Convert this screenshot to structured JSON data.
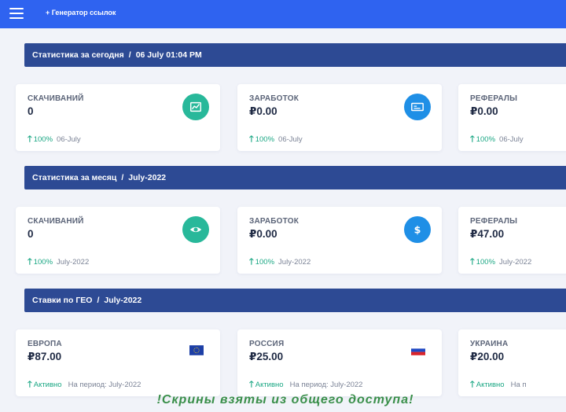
{
  "header": {
    "link_label": "+ Генератор ссылок"
  },
  "sections": {
    "today": {
      "label": "Статистика за сегодня",
      "period": "06 July 01:04 PM"
    },
    "month": {
      "label": "Статистика за месяц",
      "period": "July-2022"
    },
    "geo": {
      "label": "Ставки по ГЕО",
      "period": "July-2022"
    }
  },
  "today_cards": [
    {
      "label": "СКАЧИВАНИЙ",
      "value": "0",
      "pct": "100%",
      "date": "06-July",
      "icon": "chart-icon",
      "color": "#28b89a"
    },
    {
      "label": "ЗАРАБОТОК",
      "value": "₽0.00",
      "pct": "100%",
      "date": "06-July",
      "icon": "money-icon",
      "color": "#1f8fe6"
    },
    {
      "label": "РЕФЕРАЛЫ",
      "value": "₽0.00",
      "pct": "100%",
      "date": "06-July"
    }
  ],
  "month_cards": [
    {
      "label": "СКАЧИВАНИЙ",
      "value": "0",
      "pct": "100%",
      "date": "July-2022",
      "icon": "eye-icon",
      "color": "#28b89a"
    },
    {
      "label": "ЗАРАБОТОК",
      "value": "₽0.00",
      "pct": "100%",
      "date": "July-2022",
      "icon": "dollar-icon",
      "color": "#1f8fe6"
    },
    {
      "label": "РЕФЕРАЛЫ",
      "value": "₽47.00",
      "pct": "100%",
      "date": "July-2022"
    }
  ],
  "geo_cards": [
    {
      "label": "ЕВРОПА",
      "value": "₽87.00",
      "status": "Активно",
      "period": "На период: July-2022",
      "icon": "eu-flag-icon"
    },
    {
      "label": "РОССИЯ",
      "value": "₽25.00",
      "status": "Активно",
      "period": "На период: July-2022",
      "icon": "russia-flag-icon"
    },
    {
      "label": "УКРАИНА",
      "value": "₽20.00",
      "status": "Активно",
      "period": "На п"
    }
  ],
  "watermark": "!Скрины взяты из общего доступа!"
}
